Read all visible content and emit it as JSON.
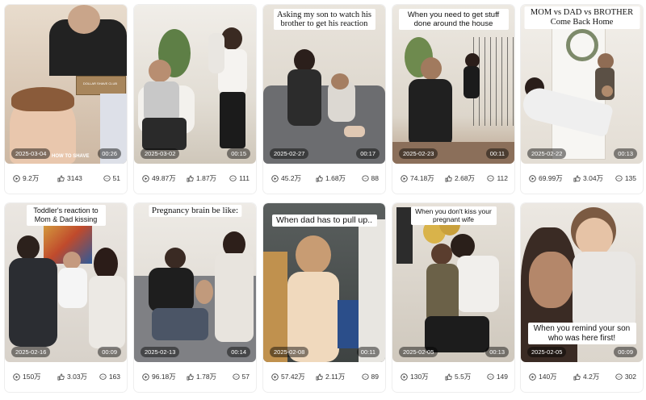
{
  "videos": [
    {
      "date": "2025-03-04",
      "duration": "00:26",
      "plays": "9.2万",
      "likes": "3143",
      "comments": "51",
      "caption": "",
      "extra": "HOW TO SHAVE",
      "box_text": "DOLLAR SHAVE CLUB"
    },
    {
      "date": "2025-03-02",
      "duration": "00:15",
      "plays": "49.87万",
      "likes": "1.87万",
      "comments": "111",
      "caption": ""
    },
    {
      "date": "2025-02-27",
      "duration": "00:17",
      "plays": "45.2万",
      "likes": "1.68万",
      "comments": "88",
      "caption": "Asking my son to watch his brother to get his reaction"
    },
    {
      "date": "2025-02-23",
      "duration": "00:11",
      "plays": "74.18万",
      "likes": "2.68万",
      "comments": "112",
      "caption": "When you need to get stuff done around the house"
    },
    {
      "date": "2025-02-22",
      "duration": "00:13",
      "plays": "69.99万",
      "likes": "3.04万",
      "comments": "135",
      "caption": "MOM vs DAD vs BROTHER Come Back Home"
    },
    {
      "date": "2025-02-16",
      "duration": "00:09",
      "plays": "150万",
      "likes": "3.03万",
      "comments": "163",
      "caption": "Toddler's reaction to Mom & Dad kissing"
    },
    {
      "date": "2025-02-13",
      "duration": "00:14",
      "plays": "96.18万",
      "likes": "1.78万",
      "comments": "57",
      "caption": "Pregnancy brain be like:"
    },
    {
      "date": "2025-02-08",
      "duration": "00:11",
      "plays": "57.42万",
      "likes": "2.11万",
      "comments": "89",
      "caption": "When dad has to pull up.."
    },
    {
      "date": "2025-02-05",
      "duration": "00:13",
      "plays": "130万",
      "likes": "5.5万",
      "comments": "149",
      "caption": "When you don't kiss your pregnant wife"
    },
    {
      "date": "2025-02-05",
      "duration": "00:09",
      "plays": "140万",
      "likes": "4.2万",
      "comments": "302",
      "caption": "When you remind your son who was here first!"
    }
  ],
  "icons": {
    "plays": "play-circle-icon",
    "likes": "thumbs-up-icon",
    "comments": "comment-icon"
  }
}
